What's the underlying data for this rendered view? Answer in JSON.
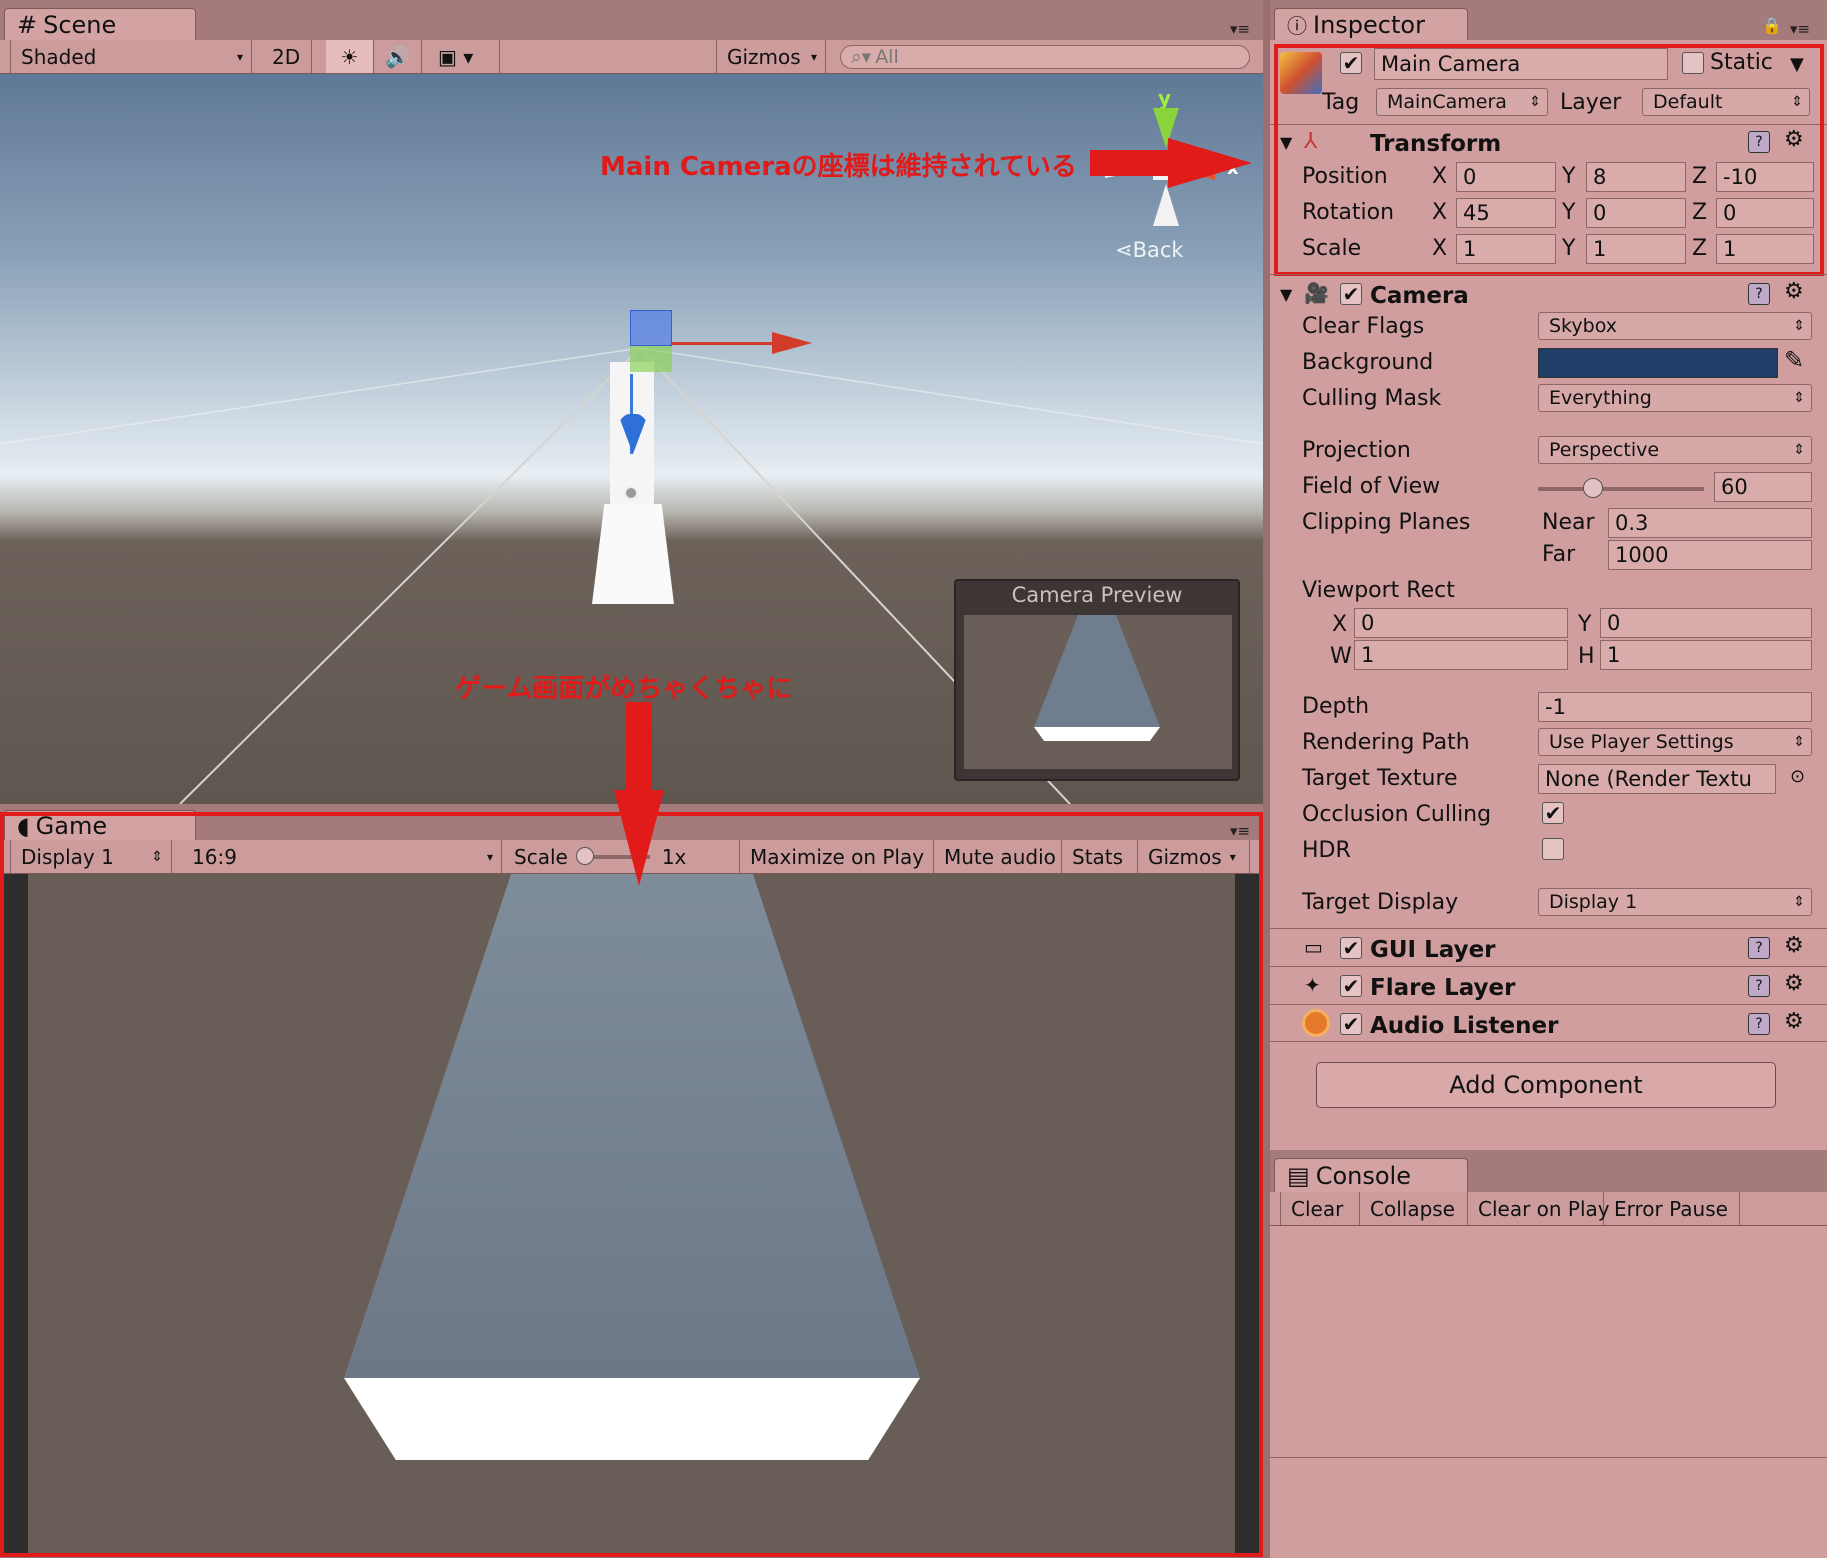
{
  "scene": {
    "tab_label": "Scene",
    "toolbar": {
      "shading": "Shaded",
      "mode_2d": "2D",
      "gizmos": "Gizmos",
      "search_placeholder": "All"
    },
    "back_label": "Back",
    "axis_y": "y",
    "axis_x": "x",
    "camera_preview_title": "Camera Preview"
  },
  "game": {
    "tab_label": "Game",
    "display": "Display 1",
    "aspect": "16:9",
    "scale_label": "Scale",
    "scale_value": "1x",
    "maximize": "Maximize on Play",
    "mute": "Mute audio",
    "stats": "Stats",
    "gizmos": "Gizmos"
  },
  "annotations": {
    "coords_kept": "Main Cameraの座標は維持されている",
    "game_broken": "ゲーム画面がめちゃくちゃに"
  },
  "inspector": {
    "tab_label": "Inspector",
    "object_name": "Main Camera",
    "static_label": "Static",
    "tag_label": "Tag",
    "tag_value": "MainCamera",
    "layer_label": "Layer",
    "layer_value": "Default",
    "transform": {
      "title": "Transform",
      "position_label": "Position",
      "rotation_label": "Rotation",
      "scale_label": "Scale",
      "axis_x": "X",
      "axis_y": "Y",
      "axis_z": "Z",
      "position": {
        "x": "0",
        "y": "8",
        "z": "-10"
      },
      "rotation": {
        "x": "45",
        "y": "0",
        "z": "0"
      },
      "scale": {
        "x": "1",
        "y": "1",
        "z": "1"
      }
    },
    "camera": {
      "title": "Camera",
      "clear_flags_label": "Clear Flags",
      "clear_flags": "Skybox",
      "background_label": "Background",
      "background_color": "#1f3d66",
      "culling_mask_label": "Culling Mask",
      "culling_mask": "Everything",
      "projection_label": "Projection",
      "projection": "Perspective",
      "fov_label": "Field of View",
      "fov": "60",
      "fov_fraction": 0.33,
      "clipping_label": "Clipping Planes",
      "near_label": "Near",
      "near": "0.3",
      "far_label": "Far",
      "far": "1000",
      "viewport_label": "Viewport Rect",
      "vx_label": "X",
      "vx": "0",
      "vy_label": "Y",
      "vy": "0",
      "vw_label": "W",
      "vw": "1",
      "vh_label": "H",
      "vh": "1",
      "depth_label": "Depth",
      "depth": "-1",
      "rendering_path_label": "Rendering Path",
      "rendering_path": "Use Player Settings",
      "target_texture_label": "Target Texture",
      "target_texture": "None (Render Textu",
      "occlusion_label": "Occlusion Culling",
      "occlusion_checked": true,
      "hdr_label": "HDR",
      "hdr_checked": false,
      "target_display_label": "Target Display",
      "target_display": "Display 1"
    },
    "gui_layer": "GUI Layer",
    "flare_layer": "Flare Layer",
    "audio_listener": "Audio Listener",
    "add_component": "Add Component"
  },
  "console": {
    "tab_label": "Console",
    "clear": "Clear",
    "collapse": "Collapse",
    "clear_on_play": "Clear on Play",
    "error_pause": "Error Pause"
  },
  "colors": {
    "accent_red": "#e11a1a",
    "panel_pink": "#d09e9e"
  }
}
